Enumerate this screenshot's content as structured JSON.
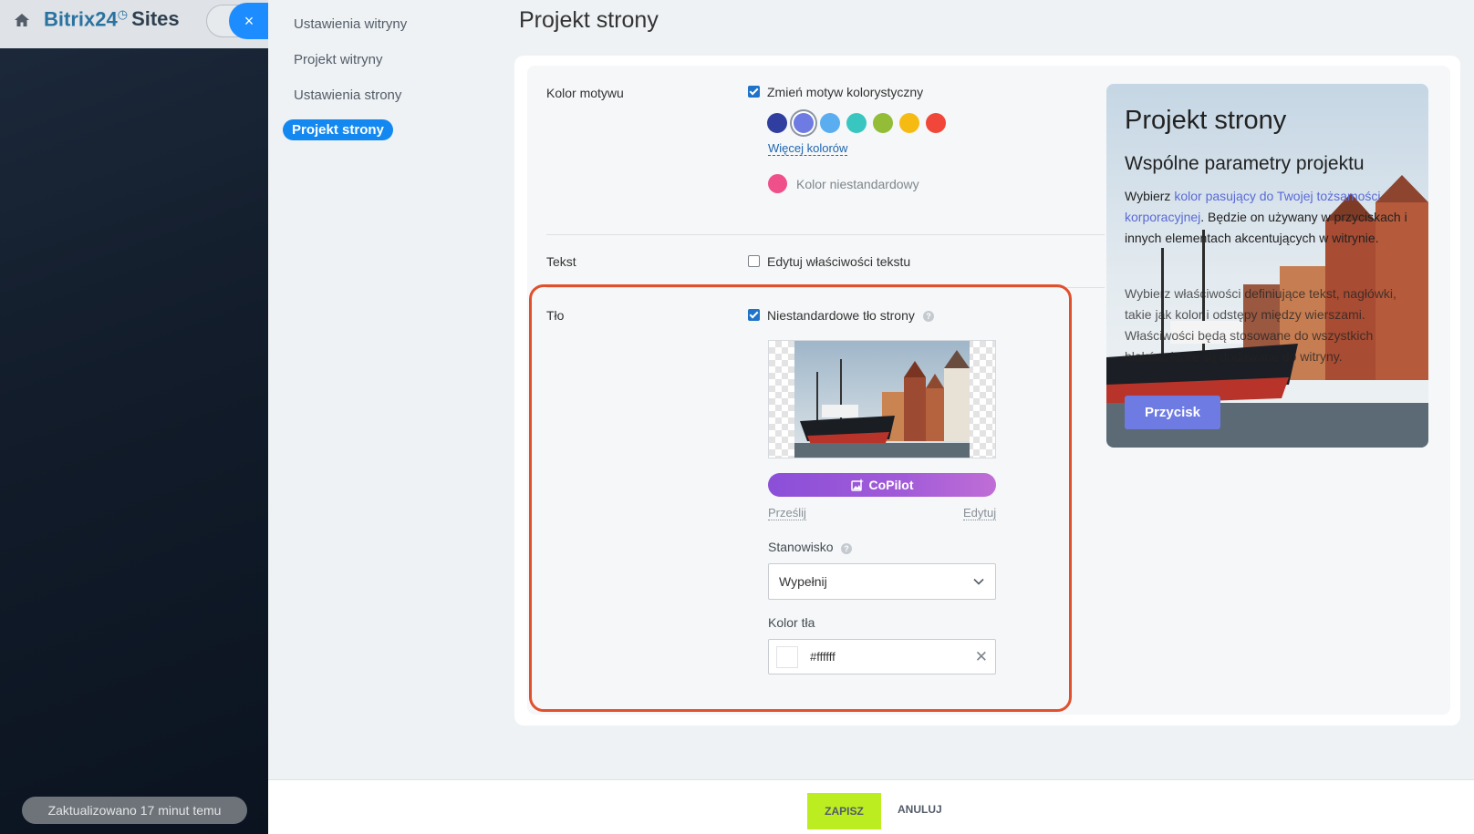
{
  "header": {
    "brand_main": "Bitrix24",
    "brand_suffix": "Sites",
    "close_label": "×"
  },
  "status": "Zaktualizowano 17 minut temu",
  "nav": {
    "items": [
      {
        "label": "Ustawienia witryny",
        "active": false
      },
      {
        "label": "Projekt witryny",
        "active": false
      },
      {
        "label": "Ustawienia strony",
        "active": false
      },
      {
        "label": "Projekt strony",
        "active": true
      }
    ]
  },
  "page_title": "Projekt strony",
  "theme": {
    "label": "Kolor motywu",
    "checkbox_label": "Zmień motyw kolorystyczny",
    "checked": true,
    "swatches": [
      "#303f9f",
      "#6e7be3",
      "#5aaef0",
      "#39c6c0",
      "#93bd36",
      "#f6bb13",
      "#f0473a"
    ],
    "selected_swatch": 1,
    "more_colors": "Więcej kolorów",
    "custom_color_label": "Kolor niestandardowy",
    "custom_color": "#f0508a"
  },
  "text": {
    "label": "Tekst",
    "checkbox_label": "Edytuj właściwości tekstu",
    "checked": false
  },
  "background": {
    "label": "Tło",
    "checkbox_label": "Niestandardowe tło strony",
    "checked": true,
    "copilot_label": "CoPilot",
    "upload_label": "Prześlij",
    "edit_label": "Edytuj",
    "position_label": "Stanowisko",
    "position_value": "Wypełnij",
    "bg_color_label": "Kolor tła",
    "bg_color_value": "#ffffff"
  },
  "preview": {
    "title": "Projekt strony",
    "subtitle": "Wspólne parametry projektu",
    "para1_before": "Wybierz ",
    "para1_link": "kolor pasujący do Twojej tożsamości korporacyjnej",
    "para1_after": ". Będzie on używany w przyciskach i innych elementach akcentujących w witrynie.",
    "para2": "Wybierz właściwości definiujące tekst, nagłówki, takie jak kolor i odstępy między wierszami. Właściwości będą stosowane do wszystkich bloków, które są dodawane do witryny.",
    "button_label": "Przycisk"
  },
  "footer": {
    "save_label": "ZAPISZ",
    "cancel_label": "ANULUJ"
  },
  "colors": {
    "accent_blue": "#1288f0",
    "highlight": "#e0502d",
    "save_green": "#bbed21"
  }
}
